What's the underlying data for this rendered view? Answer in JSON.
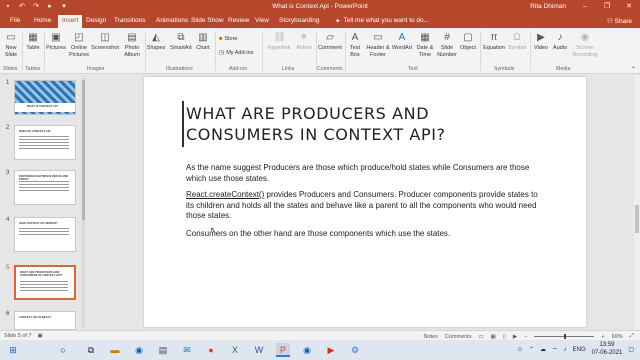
{
  "titlebar": {
    "doc_title": "What is Context Api - PowerPoint",
    "user": "Rita Dhiman",
    "minimize": "–",
    "restore": "❐",
    "close": "✕"
  },
  "tabs": {
    "items": [
      "File",
      "Home",
      "Insert",
      "Design",
      "Transitions",
      "Slide Show",
      "Review",
      "View",
      "Storyboarding"
    ],
    "active": "Insert",
    "tell_me": "Tell me what you want to do...",
    "share": "Share"
  },
  "ribbon": {
    "new_slide": "New Slide",
    "table": "Table",
    "pictures": "Pictures",
    "online_pictures": "Online Pictures",
    "screenshot": "Screenshot",
    "photo_album": "Photo Album",
    "shapes": "Shapes",
    "smartart": "SmartArt",
    "chart": "Chart",
    "store": "Store",
    "my_addins": "My Add-ins",
    "hyperlink": "Hyperlink",
    "action": "Action",
    "comment": "Comment",
    "text_box": "Text Box",
    "header_footer": "Header & Footer",
    "wordart": "WordArt",
    "date_time": "Date & Time",
    "slide_number": "Slide Number",
    "object": "Object",
    "equation": "Equation",
    "symbol": "Symbol",
    "video": "Video",
    "audio": "Audio",
    "screen_recording": "Screen Recording",
    "groups": [
      "Slides",
      "Tables",
      "Images",
      "Illustrations",
      "Add-ins",
      "Links",
      "Comments",
      "Text",
      "Symbols",
      "Media"
    ]
  },
  "thumbnails": [
    {
      "num": "1",
      "title": "WHAT IS CONTEXT API",
      "style": "pattern"
    },
    {
      "num": "2",
      "title": "NEED OF CONTEXT API",
      "style": "text"
    },
    {
      "num": "3",
      "title": "DIFFERENCE BETWEEN REDUX AND PROPS",
      "style": "text"
    },
    {
      "num": "4",
      "title": "HOW CONTEXT API WORKS?",
      "style": "text"
    },
    {
      "num": "5",
      "title": "WHAT ARE PRODUCERS AND CONSUMERS IN CONTEXT API?",
      "style": "text",
      "active": true
    },
    {
      "num": "6",
      "title": "CONTEXT API IN REACT",
      "style": "text"
    }
  ],
  "slide": {
    "title": "What are Producers and Consumers in Context API?",
    "p1": "As the name suggest Producers are those which produce/hold states while Consumers are those which use those states.",
    "p2_link": "React.createContext()",
    "p2_rest": " provides Producers and Consumers. Producer components provide states to its children and holds all the states and behave like a parent to all the components who would need those states.",
    "p3": "Consumers on the other hand are those components which use the states."
  },
  "status": {
    "slide_info": "Slide 5 of 7",
    "notes": "Notes",
    "comments": "Comments",
    "zoom": "69%"
  },
  "taskbar": {
    "time": "13:59",
    "date": "07-06-2021",
    "lang": "ENG"
  },
  "colors": {
    "accent": "#b7472a",
    "active_thumb_border": "#d06a3a"
  }
}
